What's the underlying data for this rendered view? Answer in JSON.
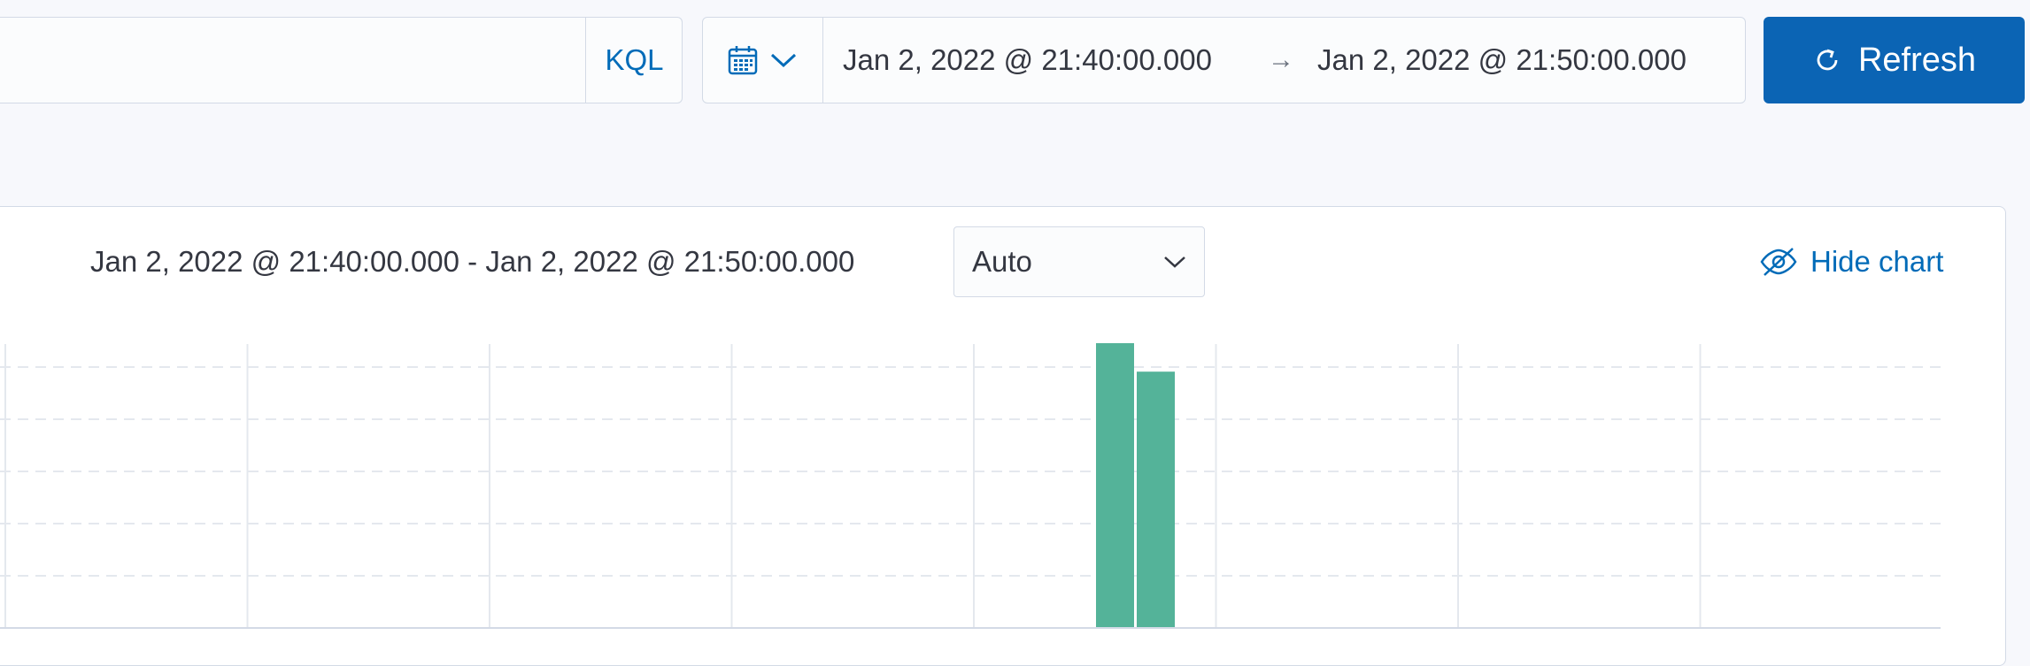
{
  "query": {
    "language_label": "KQL"
  },
  "date_picker": {
    "start": "Jan 2, 2022 @ 21:40:00.000",
    "arrow": "→",
    "end": "Jan 2, 2022 @ 21:50:00.000"
  },
  "refresh": {
    "label": "Refresh",
    "icon": "refresh-icon"
  },
  "histogram_header": {
    "range": "Jan 2, 2022 @ 21:40:00.000 - Jan 2, 2022 @ 21:50:00.000",
    "interval": "Auto",
    "hide_chart_label": "Hide chart"
  },
  "colors": {
    "accent": "#0b64b4",
    "bar": "#54b399",
    "link": "#006bb8"
  },
  "chart_data": {
    "type": "bar",
    "xlabel": "",
    "ylabel": "",
    "grid": true,
    "x_gridlines": 8,
    "y_gridlines": 5,
    "bars": [
      {
        "value": 1.0
      },
      {
        "value": 0.9
      }
    ],
    "ylim": [
      0,
      1.0
    ]
  }
}
